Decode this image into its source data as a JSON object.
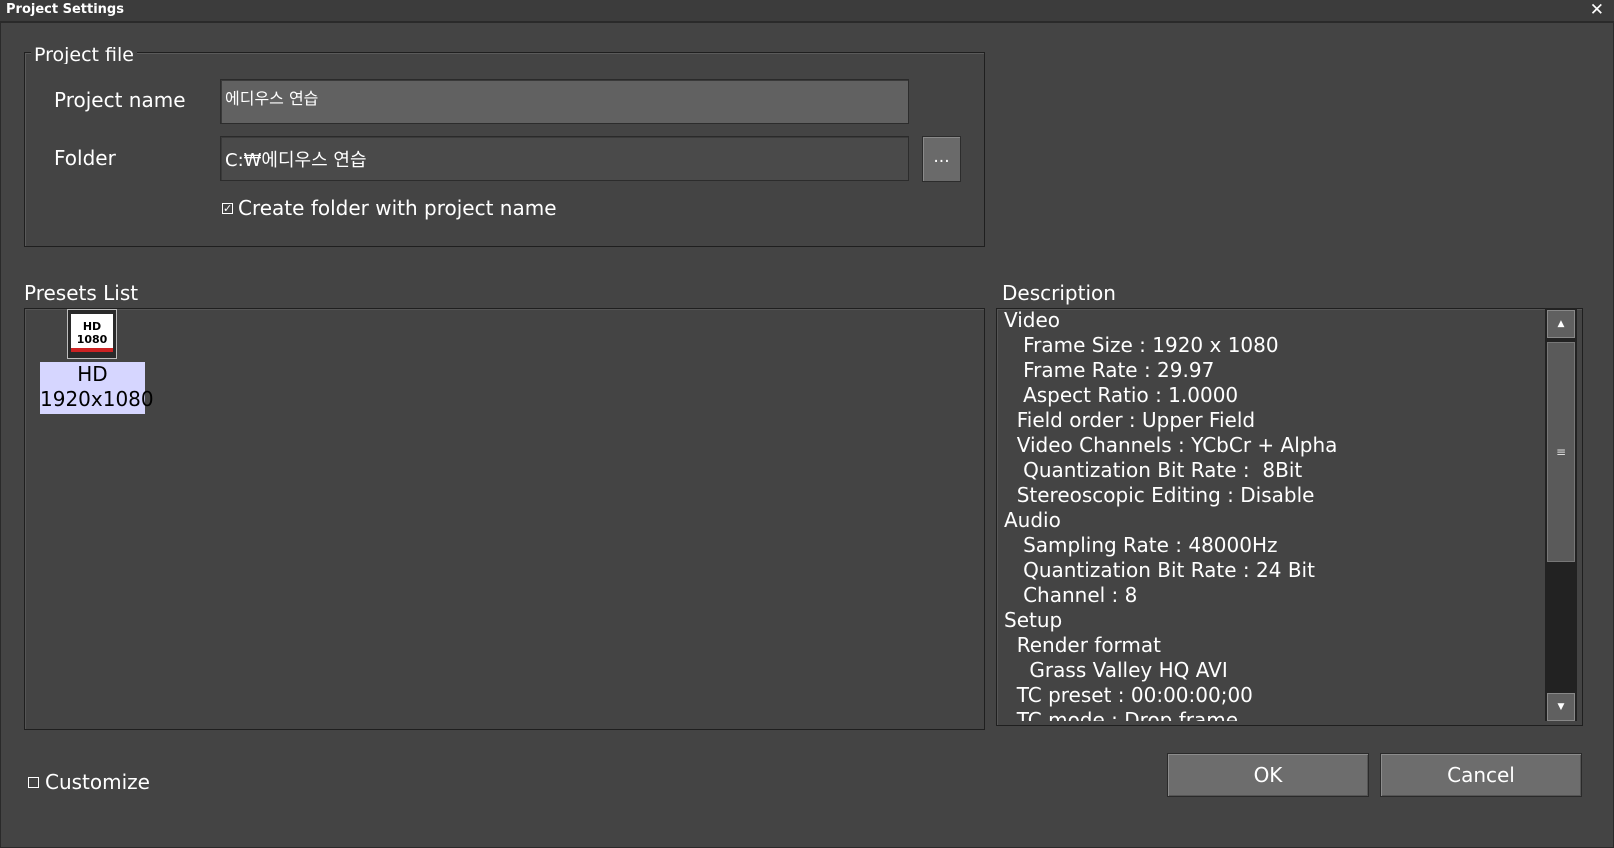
{
  "window": {
    "title": "Project Settings",
    "close_glyph": "✕"
  },
  "project_file": {
    "legend": "Project file",
    "name_label": "Project name",
    "name_value": "에디우스 연습",
    "folder_label": "Folder",
    "folder_value": "C:₩에디우스 연습",
    "browse_label": "...",
    "create_folder_label": "Create folder with project name",
    "create_folder_checked": true
  },
  "presets": {
    "label": "Presets List",
    "items": [
      {
        "icon": "hd-1080-icon",
        "icon_text_top": "HD",
        "icon_text_bottom": "1080",
        "line1": "HD",
        "line2": "1920x1080",
        "selected": true
      }
    ]
  },
  "description": {
    "label": "Description",
    "lines": [
      "Video",
      "   Frame Size : 1920 x 1080",
      "   Frame Rate : 29.97",
      "   Aspect Ratio : 1.0000",
      "  Field order : Upper Field",
      "  Video Channels : YCbCr + Alpha",
      "   Quantization Bit Rate :  8Bit",
      "  Stereoscopic Editing : Disable",
      "Audio",
      "   Sampling Rate : 48000Hz",
      "   Quantization Bit Rate : 24 Bit",
      "   Channel : 8",
      "Setup",
      "  Render format",
      "    Grass Valley HQ AVI",
      "  TC preset : 00:00:00;00",
      "  TC mode : Drop frame"
    ]
  },
  "scrollbar": {
    "up_glyph": "▲",
    "down_glyph": "▼",
    "thumb_glyph": "≡"
  },
  "customize": {
    "label": "Customize",
    "checked": false
  },
  "buttons": {
    "ok": "OK",
    "cancel": "Cancel"
  },
  "colors": {
    "background": "#444444",
    "selection": "#d6d6ff",
    "accent_red": "#cc2222"
  }
}
